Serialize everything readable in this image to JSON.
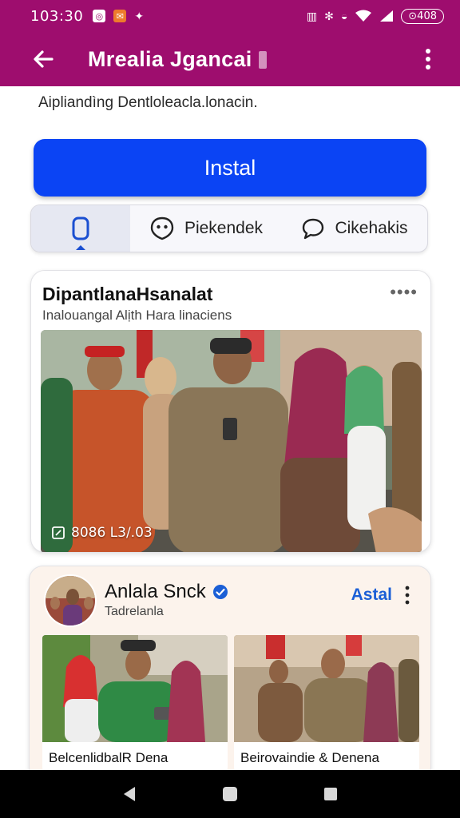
{
  "status_bar": {
    "time": "103:30",
    "battery": "⊙408"
  },
  "app_bar": {
    "title": "Mrealia Jgancai"
  },
  "description": "Aipliandìng Dentloleacla.lonacin.",
  "install": {
    "label": "Instal"
  },
  "tabs": [
    {
      "label": ""
    },
    {
      "label": "Piekendek"
    },
    {
      "label": "Cikehakis"
    }
  ],
  "post1": {
    "title": "DipantlanaHsanalat",
    "subtitle": "Inalouangal Alịth Hara linaciens",
    "photo_caption": "8086 L3/.03"
  },
  "post2": {
    "name": "Anlala Snck",
    "handle": "Tadrelanla",
    "action": "Astal",
    "thumbs": [
      {
        "label": "BelcenlidbalR Dena"
      },
      {
        "label": "Beirovaindie & Denena"
      }
    ]
  },
  "colors": {
    "app_bar": "#9e0d6e",
    "install_button": "#0b44f4",
    "accent_link": "#1b5fd6",
    "verified_badge": "#1b5fd6"
  },
  "icons": {
    "back": "arrow-left-icon",
    "overflow": "more-vertical-icon",
    "tab1": "phone-icon",
    "tab2": "heart-chat-icon",
    "tab3": "chat-bubble-icon",
    "verified": "verified-check-icon"
  }
}
